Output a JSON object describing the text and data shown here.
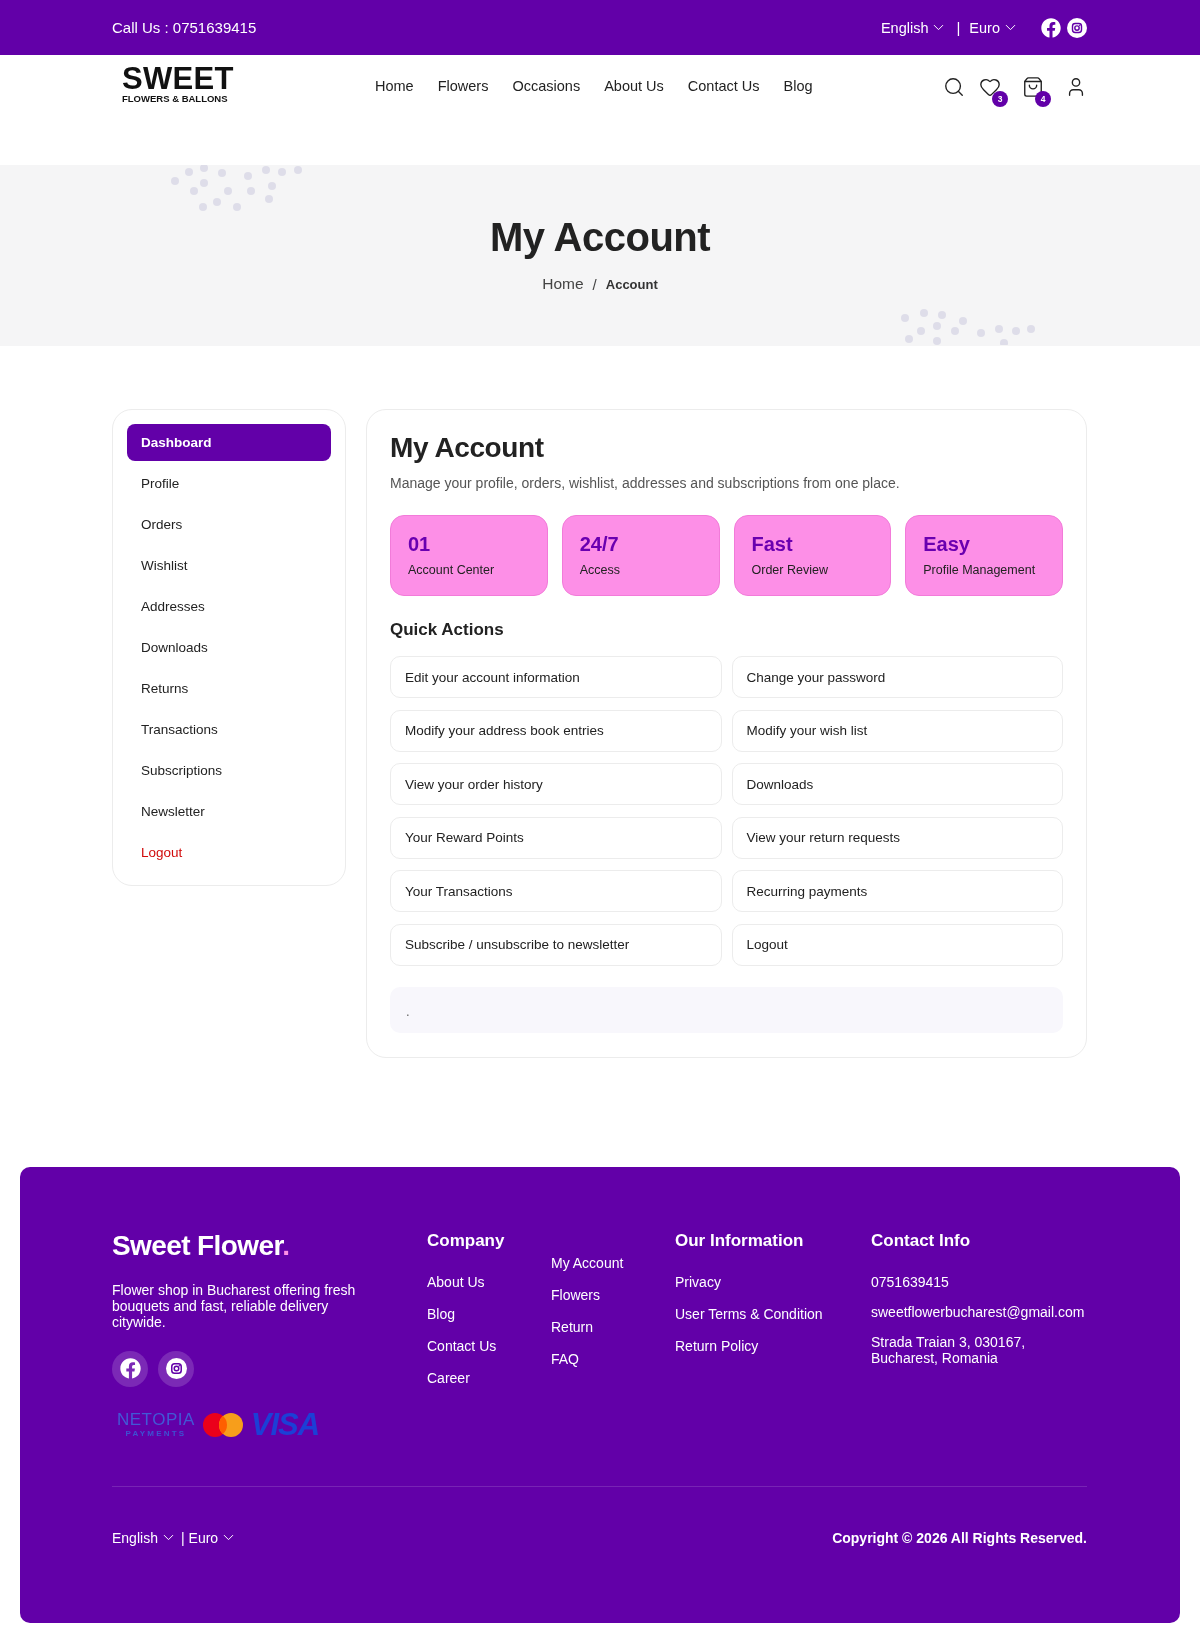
{
  "top_bar": {
    "call": "Call Us : 0751639415",
    "language": "English",
    "separator": "|",
    "currency": "Euro",
    "socials": [
      {
        "kind": "facebook"
      },
      {
        "kind": "instagram"
      }
    ]
  },
  "header": {
    "logo": {
      "title": "SWEET",
      "subtitle": "FLOWERS & BALLONS"
    },
    "nav": [
      {
        "label": "Home"
      },
      {
        "label": "Flowers"
      },
      {
        "label": "Occasions"
      },
      {
        "label": "About Us"
      },
      {
        "label": "Contact Us"
      },
      {
        "label": "Blog"
      }
    ],
    "actions": [
      {
        "kind": "search"
      },
      {
        "kind": "wishlist",
        "count": "3"
      },
      {
        "kind": "cart",
        "count": "4"
      },
      {
        "kind": "account"
      }
    ]
  },
  "hero": {
    "title": "My Account",
    "breadcrumb": {
      "items": [
        "Home",
        "Account"
      ],
      "separator": "/"
    }
  },
  "sidebar": {
    "items": [
      {
        "label": "Dashboard",
        "selected": true,
        "kind": "link"
      },
      {
        "label": "Profile",
        "selected": false,
        "kind": "link"
      },
      {
        "label": "Orders",
        "selected": false,
        "kind": "link"
      },
      {
        "label": "Wishlist",
        "selected": false,
        "kind": "link"
      },
      {
        "label": "Addresses",
        "selected": false,
        "kind": "link"
      },
      {
        "label": "Downloads",
        "selected": false,
        "kind": "link"
      },
      {
        "label": "Returns",
        "selected": false,
        "kind": "link"
      },
      {
        "label": "Transactions",
        "selected": false,
        "kind": "link"
      },
      {
        "label": "Subscriptions",
        "selected": false,
        "kind": "link"
      },
      {
        "label": "Newsletter",
        "selected": false,
        "kind": "link"
      },
      {
        "label": "Logout",
        "selected": false,
        "kind": "danger"
      }
    ]
  },
  "account": {
    "title": "My Account",
    "subtitle": "Manage your profile, orders, wishlist, addresses and subscriptions from one place.",
    "stats": [
      {
        "value": "01",
        "label": "Account Center"
      },
      {
        "value": "24/7",
        "label": "Access"
      },
      {
        "value": "Fast",
        "label": "Order Review"
      },
      {
        "value": "Easy",
        "label": "Profile Management"
      }
    ],
    "quick_actions": {
      "title": "Quick Actions",
      "items": [
        "Edit your account information",
        "Change your password",
        "Modify your address book entries",
        "Modify your wish list",
        "View your order history",
        "Downloads",
        "Your Reward Points",
        "View your return requests",
        "Your Transactions",
        "Recurring payments",
        "Subscribe / unsubscribe to newsletter",
        "Logout"
      ]
    },
    "note": "."
  },
  "footer": {
    "brand": {
      "name": "Sweet Flower",
      "mark": "."
    },
    "description": "Flower shop in Bucharest offering fresh bouquets and fast, reliable delivery citywide.",
    "socials": [
      {
        "kind": "facebook"
      },
      {
        "kind": "instagram"
      }
    ],
    "payments": [
      {
        "kind": "netopia",
        "label": "NETOPIA",
        "sublabel": "PAYMENTS"
      },
      {
        "kind": "mastercard"
      },
      {
        "kind": "visa",
        "label": "VISA"
      }
    ],
    "columns": [
      {
        "kind": "links",
        "title": "Company",
        "items": [
          "About Us",
          "Blog",
          "Contact Us",
          "Career"
        ]
      },
      {
        "kind": "links",
        "items": [
          "My Account",
          "Flowers",
          "Return",
          "FAQ"
        ]
      },
      {
        "kind": "links",
        "title": "Our Information",
        "items": [
          "Privacy",
          "User Terms & Condition",
          "Return Policy"
        ]
      },
      {
        "kind": "contact",
        "title": "Contact Info",
        "items": [
          "0751639415",
          "sweetflowerbucharest@gmail.com",
          "Strada Traian 3, 030167, Bucharest, Romania"
        ]
      }
    ],
    "language": "English",
    "separator": "|",
    "currency": "Euro",
    "copyright": "Copyright © 2026 All Rights Reserved."
  }
}
